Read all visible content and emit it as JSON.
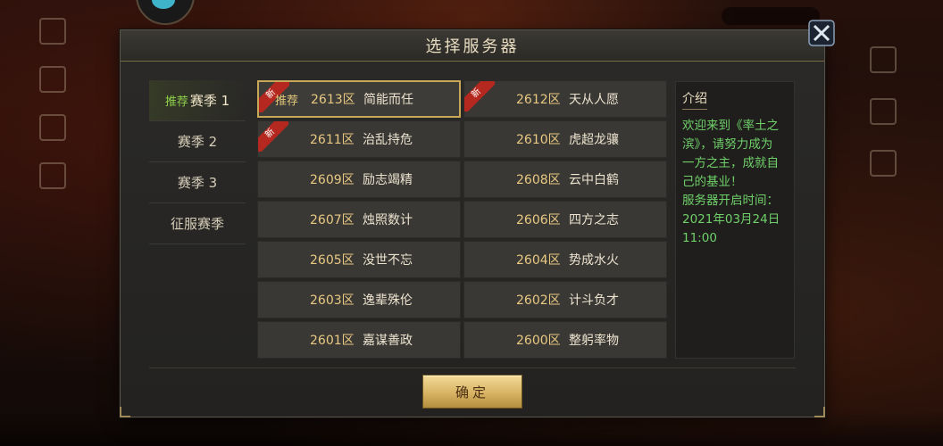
{
  "dialog": {
    "title": "选择服务器",
    "confirm_label": "确定"
  },
  "seasons": [
    {
      "prefix": "推荐",
      "label": "赛季 1",
      "active": true
    },
    {
      "prefix": "",
      "label": "赛季 2",
      "active": false
    },
    {
      "prefix": "",
      "label": "赛季 3",
      "active": false
    },
    {
      "prefix": "",
      "label": "征服赛季",
      "active": false
    }
  ],
  "servers": [
    {
      "tag": "推荐",
      "number": "2613区",
      "name": "简能而任",
      "new_badge": "新",
      "selected": true
    },
    {
      "tag": "",
      "number": "2612区",
      "name": "天从人愿",
      "new_badge": "新",
      "selected": false
    },
    {
      "tag": "",
      "number": "2611区",
      "name": "治乱持危",
      "new_badge": "新",
      "selected": false
    },
    {
      "tag": "",
      "number": "2610区",
      "name": "虎超龙骧",
      "new_badge": "",
      "selected": false
    },
    {
      "tag": "",
      "number": "2609区",
      "name": "励志竭精",
      "new_badge": "",
      "selected": false
    },
    {
      "tag": "",
      "number": "2608区",
      "name": "云中白鹤",
      "new_badge": "",
      "selected": false
    },
    {
      "tag": "",
      "number": "2607区",
      "name": "烛照数计",
      "new_badge": "",
      "selected": false
    },
    {
      "tag": "",
      "number": "2606区",
      "name": "四方之志",
      "new_badge": "",
      "selected": false
    },
    {
      "tag": "",
      "number": "2605区",
      "name": "没世不忘",
      "new_badge": "",
      "selected": false
    },
    {
      "tag": "",
      "number": "2604区",
      "name": "势成水火",
      "new_badge": "",
      "selected": false
    },
    {
      "tag": "",
      "number": "2603区",
      "name": "逸辈殊伦",
      "new_badge": "",
      "selected": false
    },
    {
      "tag": "",
      "number": "2602区",
      "name": "计斗负才",
      "new_badge": "",
      "selected": false
    },
    {
      "tag": "",
      "number": "2601区",
      "name": "嘉谋善政",
      "new_badge": "",
      "selected": false
    },
    {
      "tag": "",
      "number": "2600区",
      "name": "整躬率物",
      "new_badge": "",
      "selected": false
    }
  ],
  "intro": {
    "title": "介绍",
    "lines": [
      "欢迎来到《率土之",
      "滨》，请努力成为",
      "一方之主，成就自",
      "己的基业！",
      "服务器开启时间：",
      "2021年03月24日",
      "11:00"
    ]
  },
  "colors": {
    "accent_gold": "#c8a857",
    "intro_text_green": "#6fd06a",
    "new_badge_red": "#b5281f",
    "server_number_gold": "#e8c981"
  },
  "icons": {
    "close": "close-x-icon",
    "new": "new-ribbon-icon"
  }
}
